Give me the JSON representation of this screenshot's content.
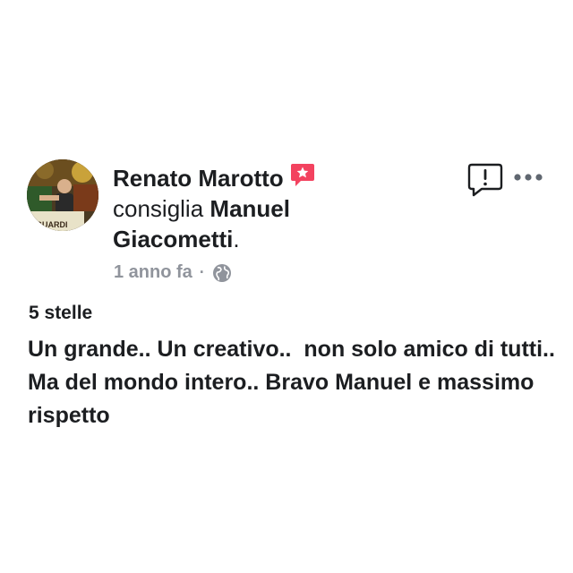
{
  "post": {
    "author": "Renato Marotto",
    "action": "consiglia",
    "page_name": "Manuel Giacometti",
    "page_suffix": ".",
    "timestamp": "1 anno fa",
    "separator": "·",
    "privacy_icon": "globe-icon",
    "badge_icon": "recommend-star-icon",
    "rating": "5 stelle",
    "review": "Un grande.. Un creativo..  non solo amico di tutti.. Ma del mondo intero.. Bravo Manuel e massimo rispetto",
    "avatar_text": "GUARDI"
  },
  "icons": {
    "report": "report-icon",
    "more": "more-options-icon"
  },
  "colors": {
    "text": "#1c1e21",
    "meta": "#90949c",
    "badge": "#f3425f",
    "icon": "#1c1e21"
  }
}
